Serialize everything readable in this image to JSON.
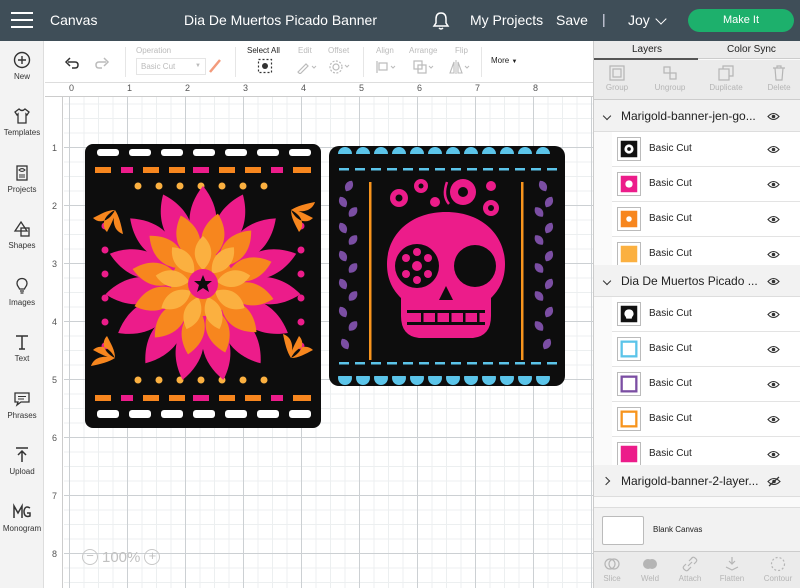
{
  "topbar": {
    "app_name": "Canvas",
    "project_title": "Dia De Muertos Picado Banner",
    "my_projects": "My Projects",
    "save": "Save",
    "separator": "|",
    "user": "Joy",
    "make_it": "Make It"
  },
  "leftrail": {
    "items": [
      {
        "label": "New",
        "icon": "plus-circle-icon"
      },
      {
        "label": "Templates",
        "icon": "shirt-icon"
      },
      {
        "label": "Projects",
        "icon": "projects-icon"
      },
      {
        "label": "Shapes",
        "icon": "shapes-icon"
      },
      {
        "label": "Images",
        "icon": "lightbulb-icon"
      },
      {
        "label": "Text",
        "icon": "text-icon"
      },
      {
        "label": "Phrases",
        "icon": "speech-bubble-icon"
      },
      {
        "label": "Upload",
        "icon": "upload-icon"
      },
      {
        "label": "Monogram",
        "icon": "monogram-icon"
      }
    ]
  },
  "toolbar": {
    "operation_label": "Operation",
    "operation_value": "Basic Cut",
    "select_all": "Select All",
    "edit": "Edit",
    "offset": "Offset",
    "align": "Align",
    "arrange": "Arrange",
    "flip": "Flip",
    "more": "More"
  },
  "rulers": {
    "horizontal": [
      "0",
      "1",
      "2",
      "3",
      "4",
      "5",
      "6",
      "7",
      "8"
    ],
    "vertical": [
      "1",
      "2",
      "3",
      "4",
      "5",
      "6",
      "7",
      "8"
    ]
  },
  "zoom": {
    "minus": "−",
    "value": "100%",
    "plus": "+"
  },
  "panel": {
    "tabs": [
      "Layers",
      "Color Sync"
    ],
    "tools": [
      "Group",
      "Ungroup",
      "Duplicate",
      "Delete"
    ],
    "group1": {
      "name": "Marigold-banner-jen-go...",
      "layers": [
        {
          "name": "Basic Cut",
          "color": "#111111"
        },
        {
          "name": "Basic Cut",
          "color": "#ec1c8a"
        },
        {
          "name": "Basic Cut",
          "color": "#f7861e"
        },
        {
          "name": "Basic Cut",
          "color": "#fbb040"
        }
      ]
    },
    "group2": {
      "name": "Dia De Muertos Picado ...",
      "layers": [
        {
          "name": "Basic Cut",
          "color": "#111111"
        },
        {
          "name": "Basic Cut",
          "color": "#5bc4e9"
        },
        {
          "name": "Basic Cut",
          "color": "#7b4ea3"
        },
        {
          "name": "Basic Cut",
          "color": "#f7941d"
        },
        {
          "name": "Basic Cut",
          "color": "#ec1c8a"
        }
      ]
    },
    "group3": {
      "name": "Marigold-banner-2-layer..."
    },
    "blank_canvas": "Blank Canvas",
    "bottom_tools": [
      "Slice",
      "Weld",
      "Attach",
      "Flatten",
      "Contour"
    ]
  }
}
